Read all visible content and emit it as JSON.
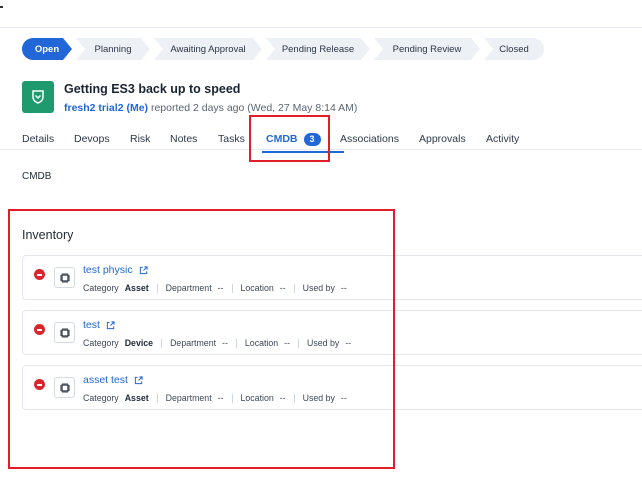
{
  "pipeline": [
    {
      "label": "Open",
      "active": true
    },
    {
      "label": "Planning",
      "active": false
    },
    {
      "label": "Awaiting Approval",
      "active": false
    },
    {
      "label": "Pending Release",
      "active": false
    },
    {
      "label": "Pending Review",
      "active": false
    },
    {
      "label": "Closed",
      "active": false
    }
  ],
  "ticket": {
    "title": "Getting ES3 back up to speed",
    "user": "fresh2 trial2 (Me)",
    "reported": "reported 2 days ago (Wed, 27 May 8:14 AM)",
    "icon": "shield-icon"
  },
  "tabs": [
    {
      "label": "Details"
    },
    {
      "label": "Devops"
    },
    {
      "label": "Risk"
    },
    {
      "label": "Notes"
    },
    {
      "label": "Tasks"
    },
    {
      "label": "CMDB",
      "badge": "3",
      "active": true
    },
    {
      "label": "Associations"
    },
    {
      "label": "Approvals"
    },
    {
      "label": "Activity"
    }
  ],
  "section_label": "CMDB",
  "inventory": {
    "title": "Inventory",
    "labels": {
      "category": "Category",
      "department": "Department",
      "location": "Location",
      "used_by": "Used by"
    },
    "items": [
      {
        "name": "test physic",
        "category": "Asset",
        "department": "--",
        "location": "--",
        "used_by": "--"
      },
      {
        "name": "test",
        "category": "Device",
        "department": "--",
        "location": "--",
        "used_by": "--"
      },
      {
        "name": "asset test",
        "category": "Asset",
        "department": "--",
        "location": "--",
        "used_by": "--"
      }
    ]
  },
  "colors": {
    "accent": "#2167d8",
    "ticket_icon": "#1f9a6e",
    "remove": "#d9262c",
    "highlight": "#e11d2a"
  }
}
